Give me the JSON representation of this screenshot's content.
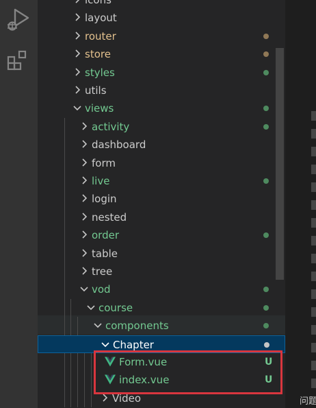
{
  "activity_bar": {
    "icons": [
      "run-debug-icon",
      "extensions-icon"
    ]
  },
  "explorer": {
    "rows": [
      {
        "label": "icons",
        "color": "#cccccc",
        "depth": 0,
        "expanded": false,
        "dot": null
      },
      {
        "label": "layout",
        "color": "#cccccc",
        "depth": 0,
        "expanded": false,
        "dot": null
      },
      {
        "label": "router",
        "color": "#e2c08d",
        "depth": 0,
        "expanded": false,
        "dot": "#8f7856"
      },
      {
        "label": "store",
        "color": "#e2c08d",
        "depth": 0,
        "expanded": false,
        "dot": "#8f7856"
      },
      {
        "label": "styles",
        "color": "#73c991",
        "depth": 0,
        "expanded": false,
        "dot": "#4e8a5f"
      },
      {
        "label": "utils",
        "color": "#cccccc",
        "depth": 0,
        "expanded": false,
        "dot": null
      },
      {
        "label": "views",
        "color": "#73c991",
        "depth": 0,
        "expanded": true,
        "dot": "#4e8a5f"
      },
      {
        "label": "activity",
        "color": "#73c991",
        "depth": 1,
        "expanded": false,
        "dot": "#4e8a5f"
      },
      {
        "label": "dashboard",
        "color": "#cccccc",
        "depth": 1,
        "expanded": false,
        "dot": null
      },
      {
        "label": "form",
        "color": "#cccccc",
        "depth": 1,
        "expanded": false,
        "dot": null
      },
      {
        "label": "live",
        "color": "#73c991",
        "depth": 1,
        "expanded": false,
        "dot": "#4e8a5f"
      },
      {
        "label": "login",
        "color": "#cccccc",
        "depth": 1,
        "expanded": false,
        "dot": null
      },
      {
        "label": "nested",
        "color": "#cccccc",
        "depth": 1,
        "expanded": false,
        "dot": null
      },
      {
        "label": "order",
        "color": "#73c991",
        "depth": 1,
        "expanded": false,
        "dot": "#4e8a5f"
      },
      {
        "label": "table",
        "color": "#cccccc",
        "depth": 1,
        "expanded": false,
        "dot": null
      },
      {
        "label": "tree",
        "color": "#cccccc",
        "depth": 1,
        "expanded": false,
        "dot": null
      },
      {
        "label": "vod",
        "color": "#73c991",
        "depth": 1,
        "expanded": true,
        "dot": "#4e8a5f"
      },
      {
        "label": "course",
        "color": "#73c991",
        "depth": 2,
        "expanded": true,
        "dot": "#4e8a5f"
      },
      {
        "label": "components",
        "color": "#73c991",
        "depth": 3,
        "expanded": true,
        "dot": "#4e8a5f"
      },
      {
        "label": "Chapter",
        "color": "#ffffff",
        "depth": 4,
        "expanded": true,
        "dot": "#c5c5c5",
        "selected": true
      },
      {
        "label": "Form.vue",
        "color": "#73c991",
        "depth": 5,
        "file": true,
        "badge": "U"
      },
      {
        "label": "index.vue",
        "color": "#73c991",
        "depth": 5,
        "file": true,
        "badge": "U"
      },
      {
        "label": "Video",
        "color": "#cccccc",
        "depth": 4,
        "expanded": false,
        "dot": null
      }
    ]
  },
  "editor": {
    "panel_tab_label": "问题"
  },
  "colors": {
    "vue_green": "#41b883",
    "vue_dark": "#35495e",
    "untracked_badge": "#73c991",
    "highlight_box": "#d9363e"
  }
}
